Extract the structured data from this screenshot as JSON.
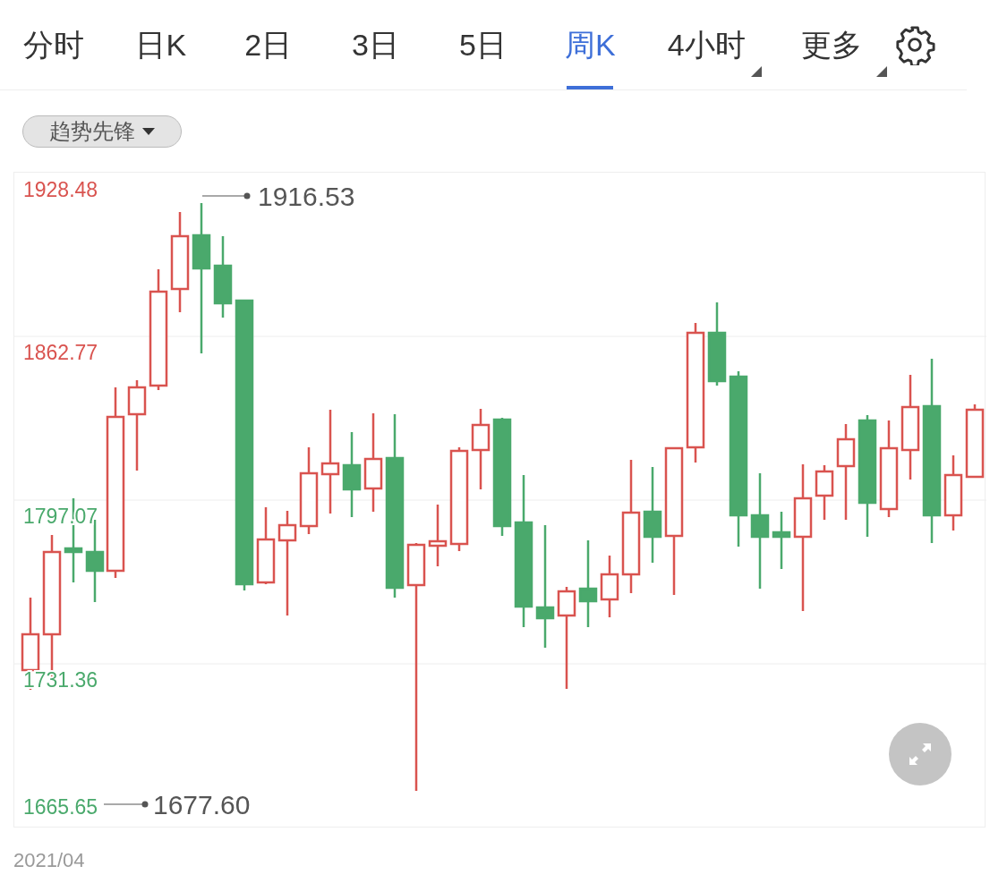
{
  "tabs": [
    {
      "label": "分时",
      "selected": false,
      "kind": "plain"
    },
    {
      "label": "日K",
      "selected": false,
      "kind": "plain"
    },
    {
      "label": "2日",
      "selected": false,
      "kind": "plain"
    },
    {
      "label": "3日",
      "selected": false,
      "kind": "plain"
    },
    {
      "label": "5日",
      "selected": false,
      "kind": "plain"
    },
    {
      "label": "周K",
      "selected": true,
      "kind": "plain"
    },
    {
      "label": "4小时",
      "selected": false,
      "kind": "menu"
    },
    {
      "label": "更多",
      "selected": false,
      "kind": "menu"
    }
  ],
  "indicator": {
    "label": "趋势先锋"
  },
  "chart": {
    "y_labels": [
      {
        "text": "1928.48",
        "color": "#d9534f"
      },
      {
        "text": "1862.77",
        "color": "#d9534f"
      },
      {
        "text": "1797.07",
        "color": "#4aa96c"
      },
      {
        "text": "1731.36",
        "color": "#4aa96c"
      },
      {
        "text": "1665.65",
        "color": "#4aa96c"
      }
    ],
    "max_label": "1916.53",
    "min_label": "1677.60"
  },
  "date_label": "2021/04"
}
